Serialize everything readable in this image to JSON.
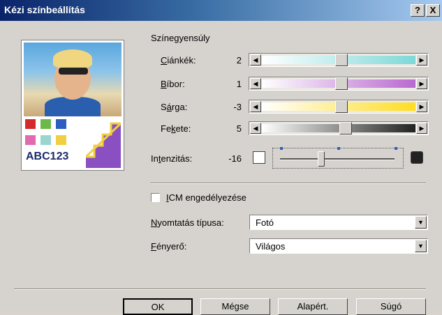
{
  "window": {
    "title": "Kézi színbeállítás",
    "help_button": "?",
    "close_button": "X"
  },
  "balance": {
    "heading": "Színegyensúly",
    "sliders": [
      {
        "label_u": "C",
        "label_rest": "iánkék:",
        "value": "2",
        "level": 0.52,
        "colors": [
          "#ffffff",
          "#7fd8d8"
        ]
      },
      {
        "label_u": "B",
        "label_rest": "íbor:",
        "value": "1",
        "level": 0.52,
        "colors": [
          "#ffffff",
          "#b86ad0"
        ]
      },
      {
        "label_pre": "S",
        "label_u": "á",
        "label_rest": "rga:",
        "value": "-3",
        "level": 0.52,
        "colors": [
          "#ffffff",
          "#ffdd22"
        ]
      },
      {
        "label_pre": "Fe",
        "label_u": "k",
        "label_rest": "ete:",
        "value": "5",
        "level": 0.55,
        "colors": [
          "#ffffff",
          "#222222"
        ]
      }
    ]
  },
  "intensity": {
    "label_pre": "In",
    "label_u": "t",
    "label_rest": "enzitás:",
    "value": "-16",
    "level": 0.36
  },
  "preview": {
    "text": "ABC123"
  },
  "icm": {
    "label_u": "I",
    "label_rest": "CM engedélyezése",
    "checked": false
  },
  "print_type": {
    "label_u": "N",
    "label_rest": "yomtatás típusa:",
    "value": "Fotó"
  },
  "brightness": {
    "label_u": "F",
    "label_rest": "ényerő:",
    "value": "Világos"
  },
  "buttons": {
    "ok": "OK",
    "cancel": "Mégse",
    "default": "Alapért.",
    "help": "Súgó"
  }
}
